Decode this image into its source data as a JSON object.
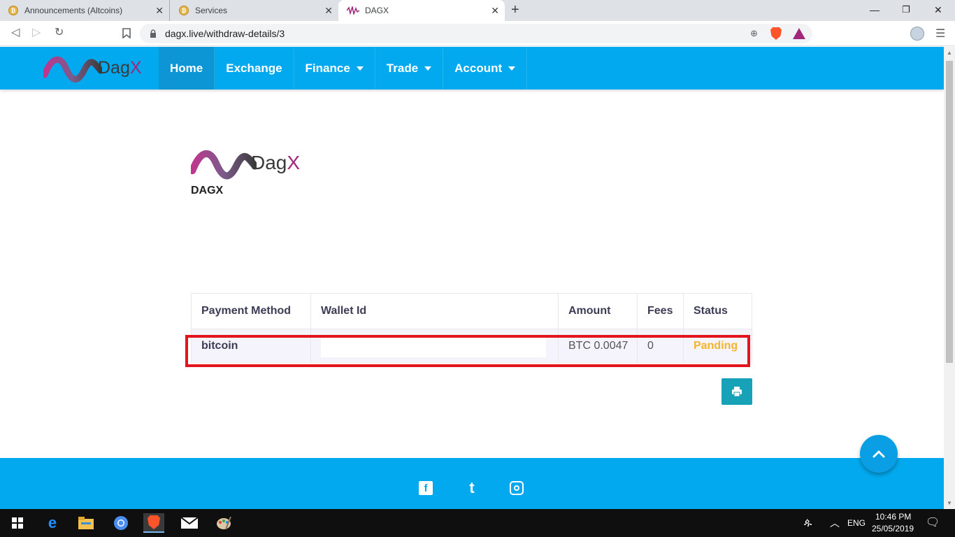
{
  "browser": {
    "tabs": [
      {
        "title": "Announcements (Altcoins)",
        "active": false
      },
      {
        "title": "Services",
        "active": false
      },
      {
        "title": "DAGX",
        "active": true
      }
    ],
    "url": "dagx.live/withdraw-details/3"
  },
  "site": {
    "logo_text": "Dag",
    "logo_x": "X",
    "nav": [
      {
        "label": "Home",
        "active": true,
        "dropdown": false
      },
      {
        "label": "Exchange",
        "active": false,
        "dropdown": false
      },
      {
        "label": "Finance",
        "active": false,
        "dropdown": true
      },
      {
        "label": "Trade",
        "active": false,
        "dropdown": true
      },
      {
        "label": "Account",
        "active": false,
        "dropdown": true
      }
    ],
    "accent_color": "#03a9ee"
  },
  "brand": {
    "logo_text": "Dag",
    "logo_x": "X",
    "name": "DAGX"
  },
  "withdraw_table": {
    "columns": [
      "Payment Method",
      "Wallet Id",
      "Amount",
      "Fees",
      "Status"
    ],
    "rows": [
      {
        "method": "bitcoin",
        "wallet_id": "",
        "amount": "BTC 0.0047",
        "fees": "0",
        "status": "Panding"
      }
    ],
    "status_color": "#f5b52a"
  },
  "buttons": {
    "print_icon": "print-icon",
    "scroll_top_icon": "chevron-up-icon"
  },
  "footer": {
    "social": [
      "facebook-icon",
      "tumblr-icon",
      "instagram-icon"
    ]
  },
  "taskbar": {
    "language": "ENG",
    "time": "10:46 PM",
    "date": "25/05/2019"
  }
}
